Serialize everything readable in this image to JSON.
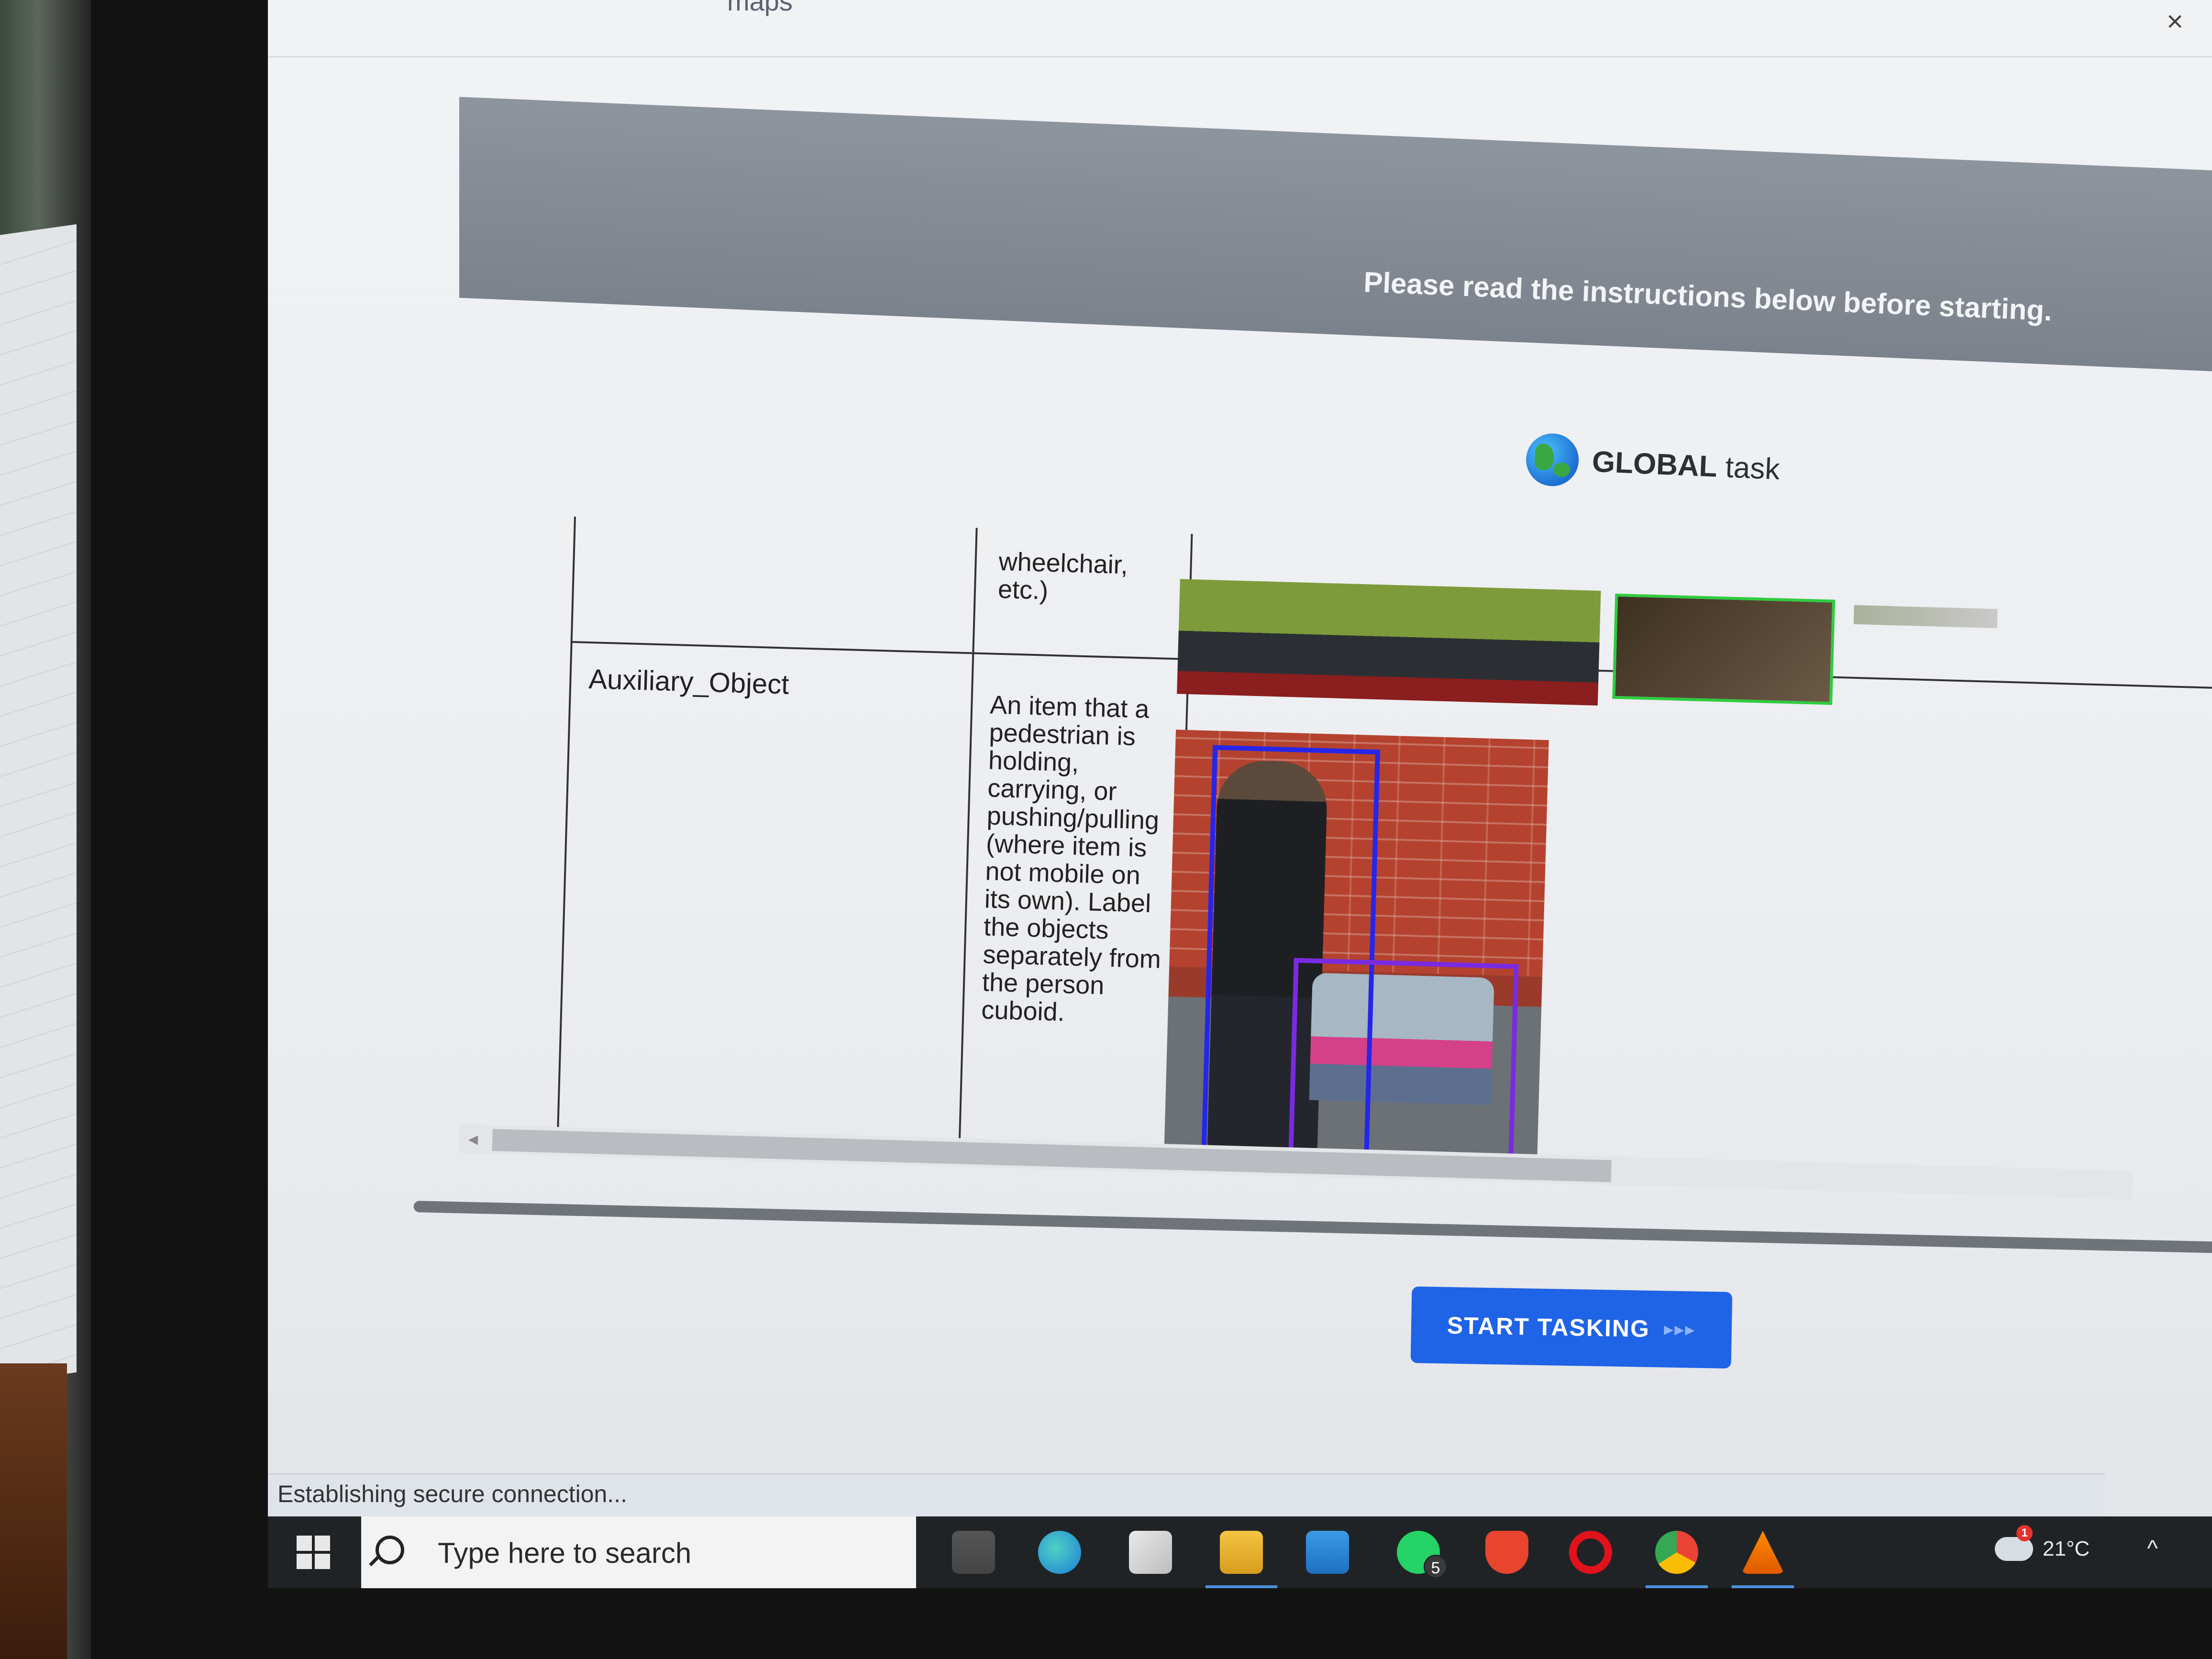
{
  "browser": {
    "tab_label": "maps",
    "close_symbol": "×"
  },
  "banner": {
    "text": "Please read the instructions below before starting."
  },
  "task_type": {
    "bold": "GLOBAL",
    "label": " task"
  },
  "table": {
    "prev_row_desc_tail": "wheelchair,\netc.)",
    "rows": [
      {
        "label": "Auxiliary_Object",
        "description": "An item that a pedestrian is holding, carrying, or pushing/pulling (where item is not mobile on its own). Label the objects separately from the person cuboid."
      }
    ]
  },
  "scroll": {
    "left_arrow": "◂"
  },
  "start_button": {
    "label": "START TASKING",
    "arrows": "▸▸▸"
  },
  "status": {
    "text": "Establishing secure connection..."
  },
  "taskbar": {
    "search_placeholder": "Type here to search",
    "whatsapp_badge": "5",
    "weather_alert": "1",
    "temperature": "21°C",
    "tray_chevron": "^"
  },
  "colors": {
    "accent_button": "#1f63e6",
    "banner": "#8a9099",
    "bbox_person": "#2626e8",
    "bbox_object": "#7a2be0",
    "bbox_top": "#2ecc40"
  }
}
